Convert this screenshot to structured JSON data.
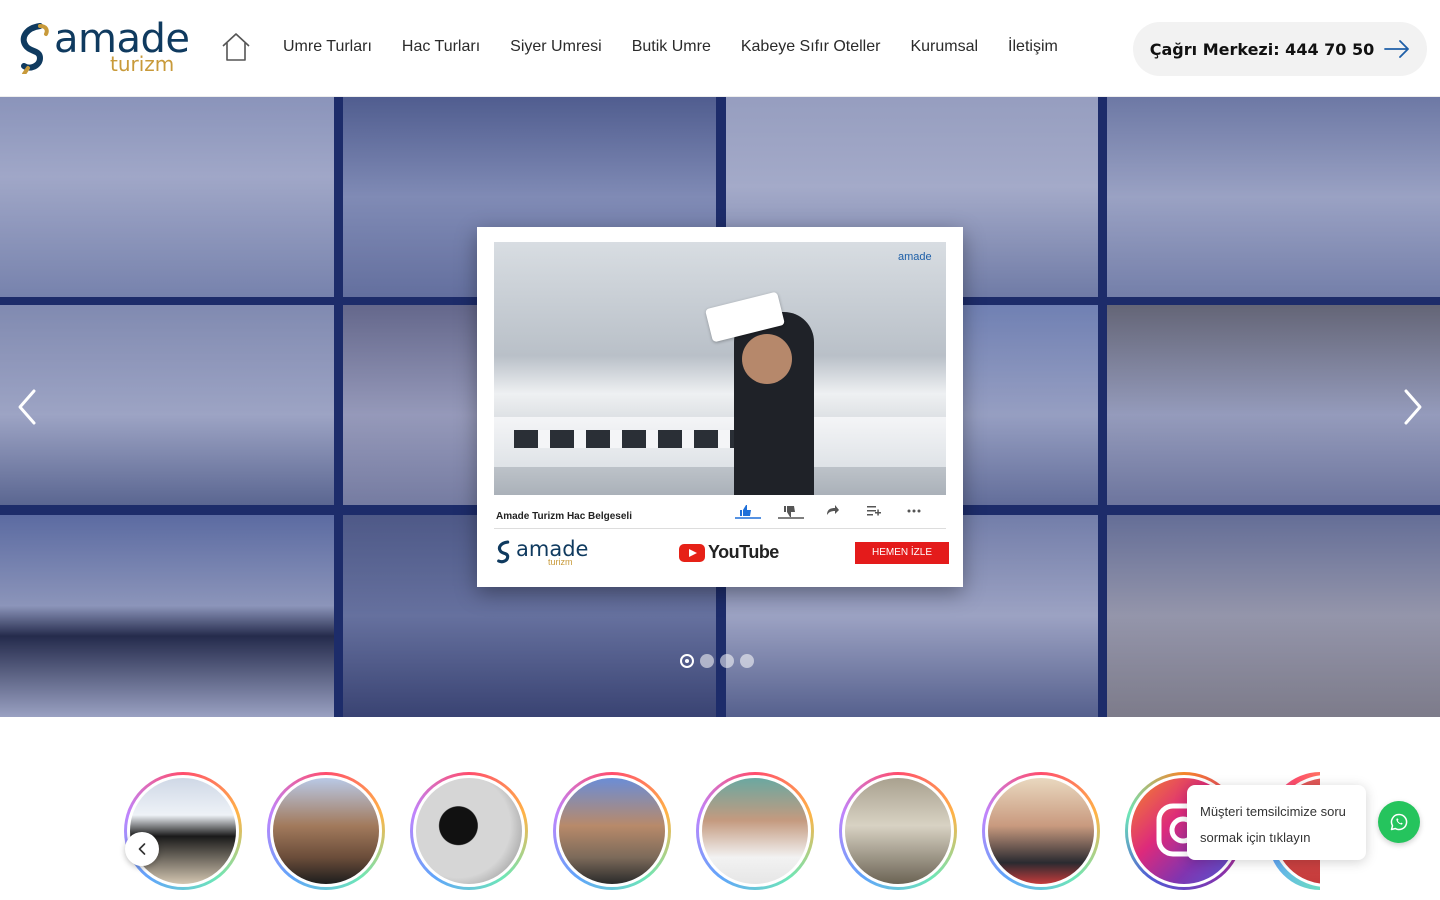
{
  "brand": {
    "name": "amade",
    "sub": "turizm"
  },
  "nav": {
    "home_icon": "home-icon",
    "items": [
      {
        "label": "Umre Turları"
      },
      {
        "label": "Hac Turları"
      },
      {
        "label": "Siyer Umresi"
      },
      {
        "label": "Butik Umre"
      },
      {
        "label": "Kabeye Sıfır Oteller"
      },
      {
        "label": "Kurumsal"
      },
      {
        "label": "İletişim"
      }
    ]
  },
  "callcenter": {
    "label": "Çağrı Merkezi: 444 70 50",
    "icon": "arrow-right-icon"
  },
  "hero": {
    "video_card": {
      "title": "Amade Turizm Hac Belgeseli",
      "brand_word": "amade",
      "brand_sub": "turizm",
      "video_logo": "amade",
      "youtube_label": "YouTube",
      "button_label": "HEMEN İZLE"
    },
    "slides": [
      {
        "active": true
      },
      {
        "active": false
      },
      {
        "active": false
      },
      {
        "active": false
      }
    ],
    "prev_icon": "chevron-left-icon",
    "next_icon": "chevron-right-icon"
  },
  "stories": {
    "prev_icon": "chevron-left-icon"
  },
  "chat": {
    "tooltip": "Müşteri temsilcimize soru sormak için tıklayın",
    "icon": "whatsapp-icon"
  },
  "colors": {
    "brand_blue": "#0f3a5f",
    "brand_gold": "#c89a3a",
    "hero_overlay": "#1d2c6a",
    "button_red": "#e41b1b",
    "whatsapp_green": "#25c45d"
  }
}
